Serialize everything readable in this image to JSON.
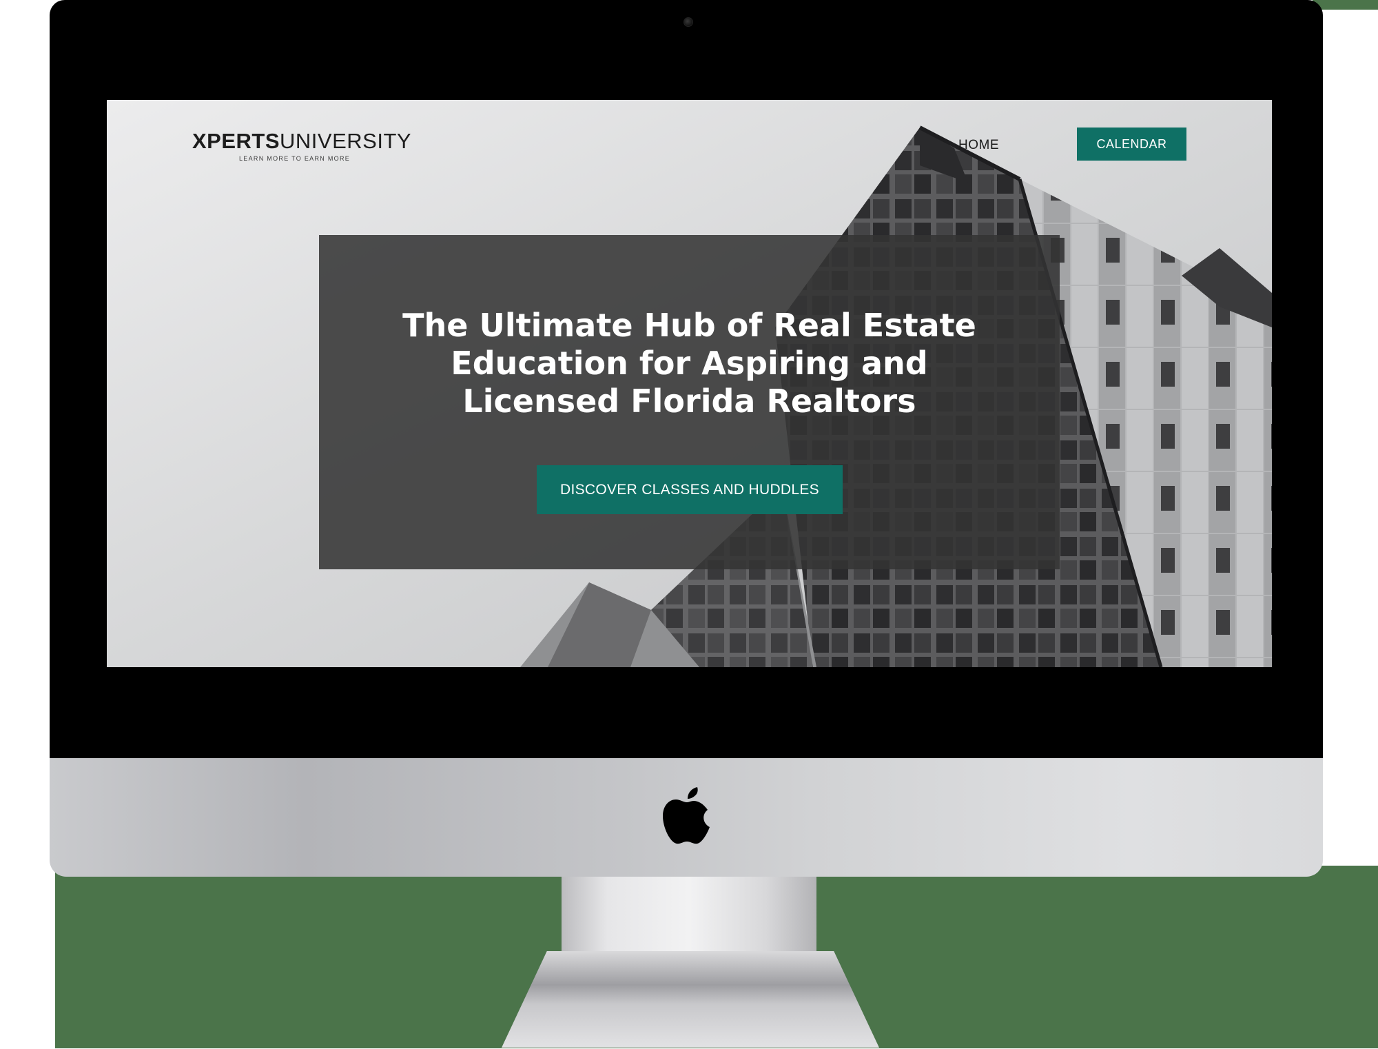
{
  "brand": {
    "name_bold": "XPERTS",
    "name_light": "UNIVERSITY",
    "tagline": "LEARN MORE TO EARN MORE"
  },
  "nav": {
    "home_label": "HOME",
    "calendar_label": "CALENDAR"
  },
  "hero": {
    "title_lines": [
      "The Ultimate Hub of Real Estate",
      "Education for Aspiring and",
      "Licensed Florida Realtors"
    ],
    "cta_label": "DISCOVER CLASSES AND HUDDLES"
  },
  "device": {
    "logo_icon": "apple-logo-icon",
    "camera_icon": "camera-icon"
  },
  "colors": {
    "accent": "#0f7065",
    "panel": "#343434",
    "bezel": "#000000",
    "matte": "#4b744a"
  }
}
